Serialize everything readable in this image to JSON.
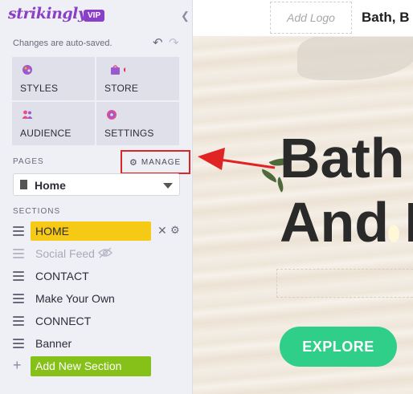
{
  "sidebar": {
    "brand": "strikingly",
    "badge": "VIP",
    "autosave_text": "Changes are auto-saved.",
    "tiles": [
      {
        "label": "STYLES",
        "icon": "palette-icon"
      },
      {
        "label": "STORE",
        "icon": "shopping-bag-icon"
      },
      {
        "label": "AUDIENCE",
        "icon": "people-icon"
      },
      {
        "label": "SETTINGS",
        "icon": "gear-icon"
      }
    ],
    "pages_header": "PAGES",
    "manage_label": "MANAGE",
    "current_page": "Home",
    "sections_header": "SECTIONS",
    "sections": [
      {
        "label": "HOME"
      },
      {
        "label": "Social Feed"
      },
      {
        "label": "CONTACT"
      },
      {
        "label": "Make Your Own"
      },
      {
        "label": "CONNECT"
      },
      {
        "label": "Banner"
      }
    ],
    "add_section_label": "Add New Section"
  },
  "preview": {
    "add_logo": "Add Logo",
    "site_name": "Bath, B",
    "hero_line1": "Bath",
    "hero_line2": "And I",
    "explore_label": "EXPLORE"
  },
  "colors": {
    "brand": "#8a3fc8",
    "home_highlight": "#f6c915",
    "add_section": "#86c11a",
    "explore": "#2fcf8a",
    "callout": "#e02424"
  }
}
